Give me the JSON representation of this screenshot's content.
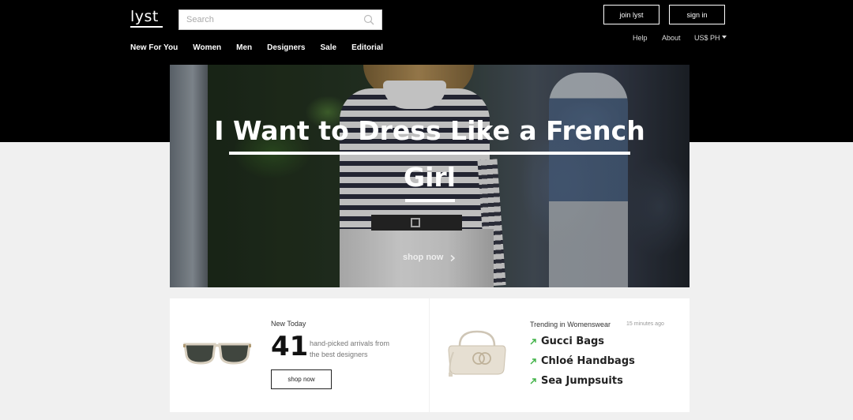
{
  "header": {
    "logo": "lyst",
    "search_placeholder": "Search",
    "join_label": "join lyst",
    "signin_label": "sign in",
    "help": "Help",
    "about": "About",
    "currency": "US$ PH"
  },
  "nav": [
    "New For You",
    "Women",
    "Men",
    "Designers",
    "Sale",
    "Editorial"
  ],
  "hero": {
    "title_line1": "I Want to Dress Like a French",
    "title_line2": "Girl",
    "cta": "shop now"
  },
  "new_today": {
    "label": "New Today",
    "count": "41",
    "desc_line1": "hand-picked arrivals from",
    "desc_line2": "the best designers",
    "button": "shop now"
  },
  "trending": {
    "label": "Trending in Womenswear",
    "time": "15 minutes ago",
    "items": [
      "Gucci Bags",
      "Chloé Handbags",
      "Sea Jumpsuits"
    ]
  },
  "colors": {
    "header_bg": "#000000",
    "trend_arrow": "#3cb043"
  }
}
